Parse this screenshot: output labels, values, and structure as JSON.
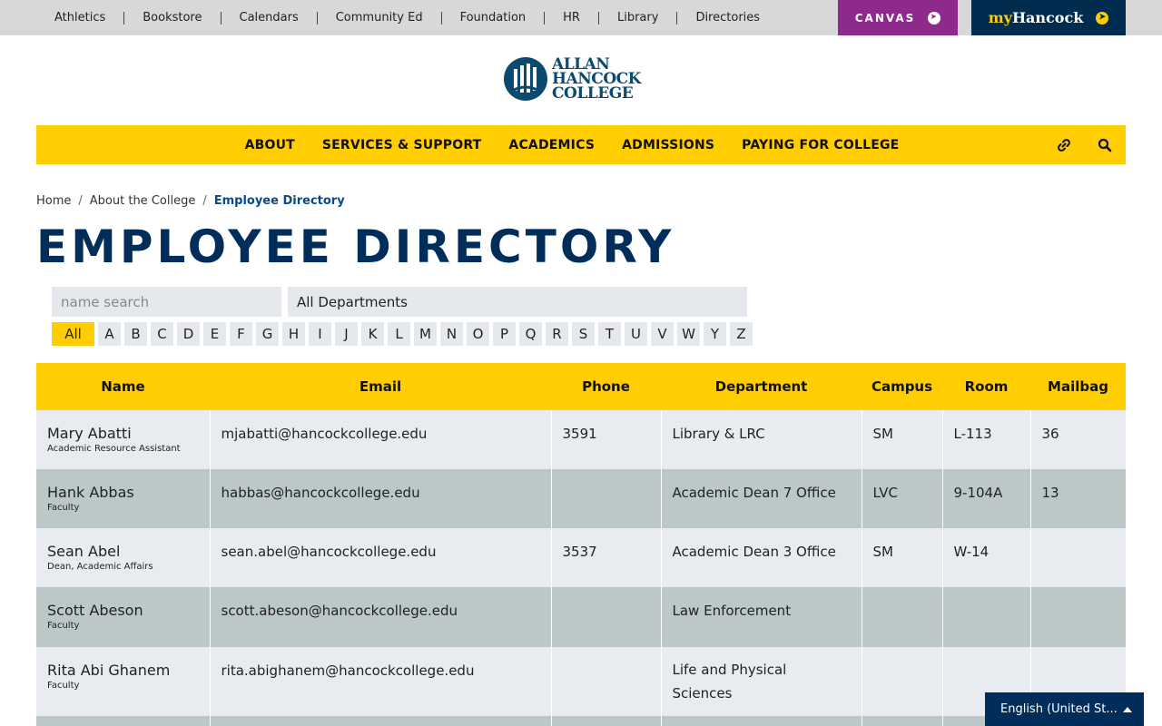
{
  "utility": {
    "links": [
      "Athletics",
      "Bookstore",
      "Calendars",
      "Community Ed",
      "Foundation",
      "HR",
      "Library",
      "Directories"
    ],
    "canvas_label": "CANVAS",
    "my_prefix": "my",
    "my_suffix": "Hancock"
  },
  "logo": {
    "line1": "ALLAN",
    "line2": "HANCOCK",
    "line3": "COLLEGE"
  },
  "nav": {
    "items": [
      "ABOUT",
      "SERVICES & SUPPORT",
      "ACADEMICS",
      "ADMISSIONS",
      "PAYING FOR COLLEGE"
    ],
    "icons": [
      "link-icon",
      "search-icon"
    ]
  },
  "breadcrumb": {
    "home": "Home",
    "about": "About the College",
    "current": "Employee Directory"
  },
  "page_title": "EMPLOYEE DIRECTORY",
  "filters": {
    "name_placeholder": "name search",
    "department_selected": "All Departments",
    "letters": [
      "All",
      "A",
      "B",
      "C",
      "D",
      "E",
      "F",
      "G",
      "H",
      "I",
      "J",
      "K",
      "L",
      "M",
      "N",
      "O",
      "P",
      "Q",
      "R",
      "S",
      "T",
      "U",
      "V",
      "W",
      "Y",
      "Z"
    ],
    "active_letter": "All"
  },
  "table": {
    "headers": [
      "Name",
      "Email",
      "Phone",
      "Department",
      "Campus",
      "Room",
      "Mailbag"
    ],
    "rows": [
      {
        "name": "Mary Abatti",
        "title": "Academic Resource Assistant",
        "email": "mjabatti@hancockcollege.edu",
        "phone": "3591",
        "department": "Library & LRC",
        "campus": "SM",
        "room": "L-113",
        "mailbag": "36"
      },
      {
        "name": "Hank Abbas",
        "title": "Faculty",
        "email": "habbas@hancockcollege.edu",
        "phone": "",
        "department": "Academic Dean 7 Office",
        "campus": "LVC",
        "room": "9-104A",
        "mailbag": "13"
      },
      {
        "name": "Sean Abel",
        "title": "Dean, Academic Affairs",
        "email": "sean.abel@hancockcollege.edu",
        "phone": "3537",
        "department": "Academic Dean 3 Office",
        "campus": "SM",
        "room": "W-14",
        "mailbag": ""
      },
      {
        "name": "Scott Abeson",
        "title": "Faculty",
        "email": "scott.abeson@hancockcollege.edu",
        "phone": "",
        "department": "Law Enforcement",
        "campus": "",
        "room": "",
        "mailbag": ""
      },
      {
        "name": "Rita Abi Ghanem",
        "title": "Faculty",
        "email": "rita.abighanem@hancockcollege.edu",
        "phone": "",
        "department": "Life and Physical Sciences",
        "campus": "",
        "room": "",
        "mailbag": ""
      }
    ]
  },
  "language": {
    "label": "English (United St..."
  },
  "colors": {
    "gold": "#ffcd00",
    "navy": "#002d5a",
    "canvas_purple": "#8e2a8b",
    "row_light": "#e8ebef",
    "row_dark": "#bcc7c7"
  }
}
